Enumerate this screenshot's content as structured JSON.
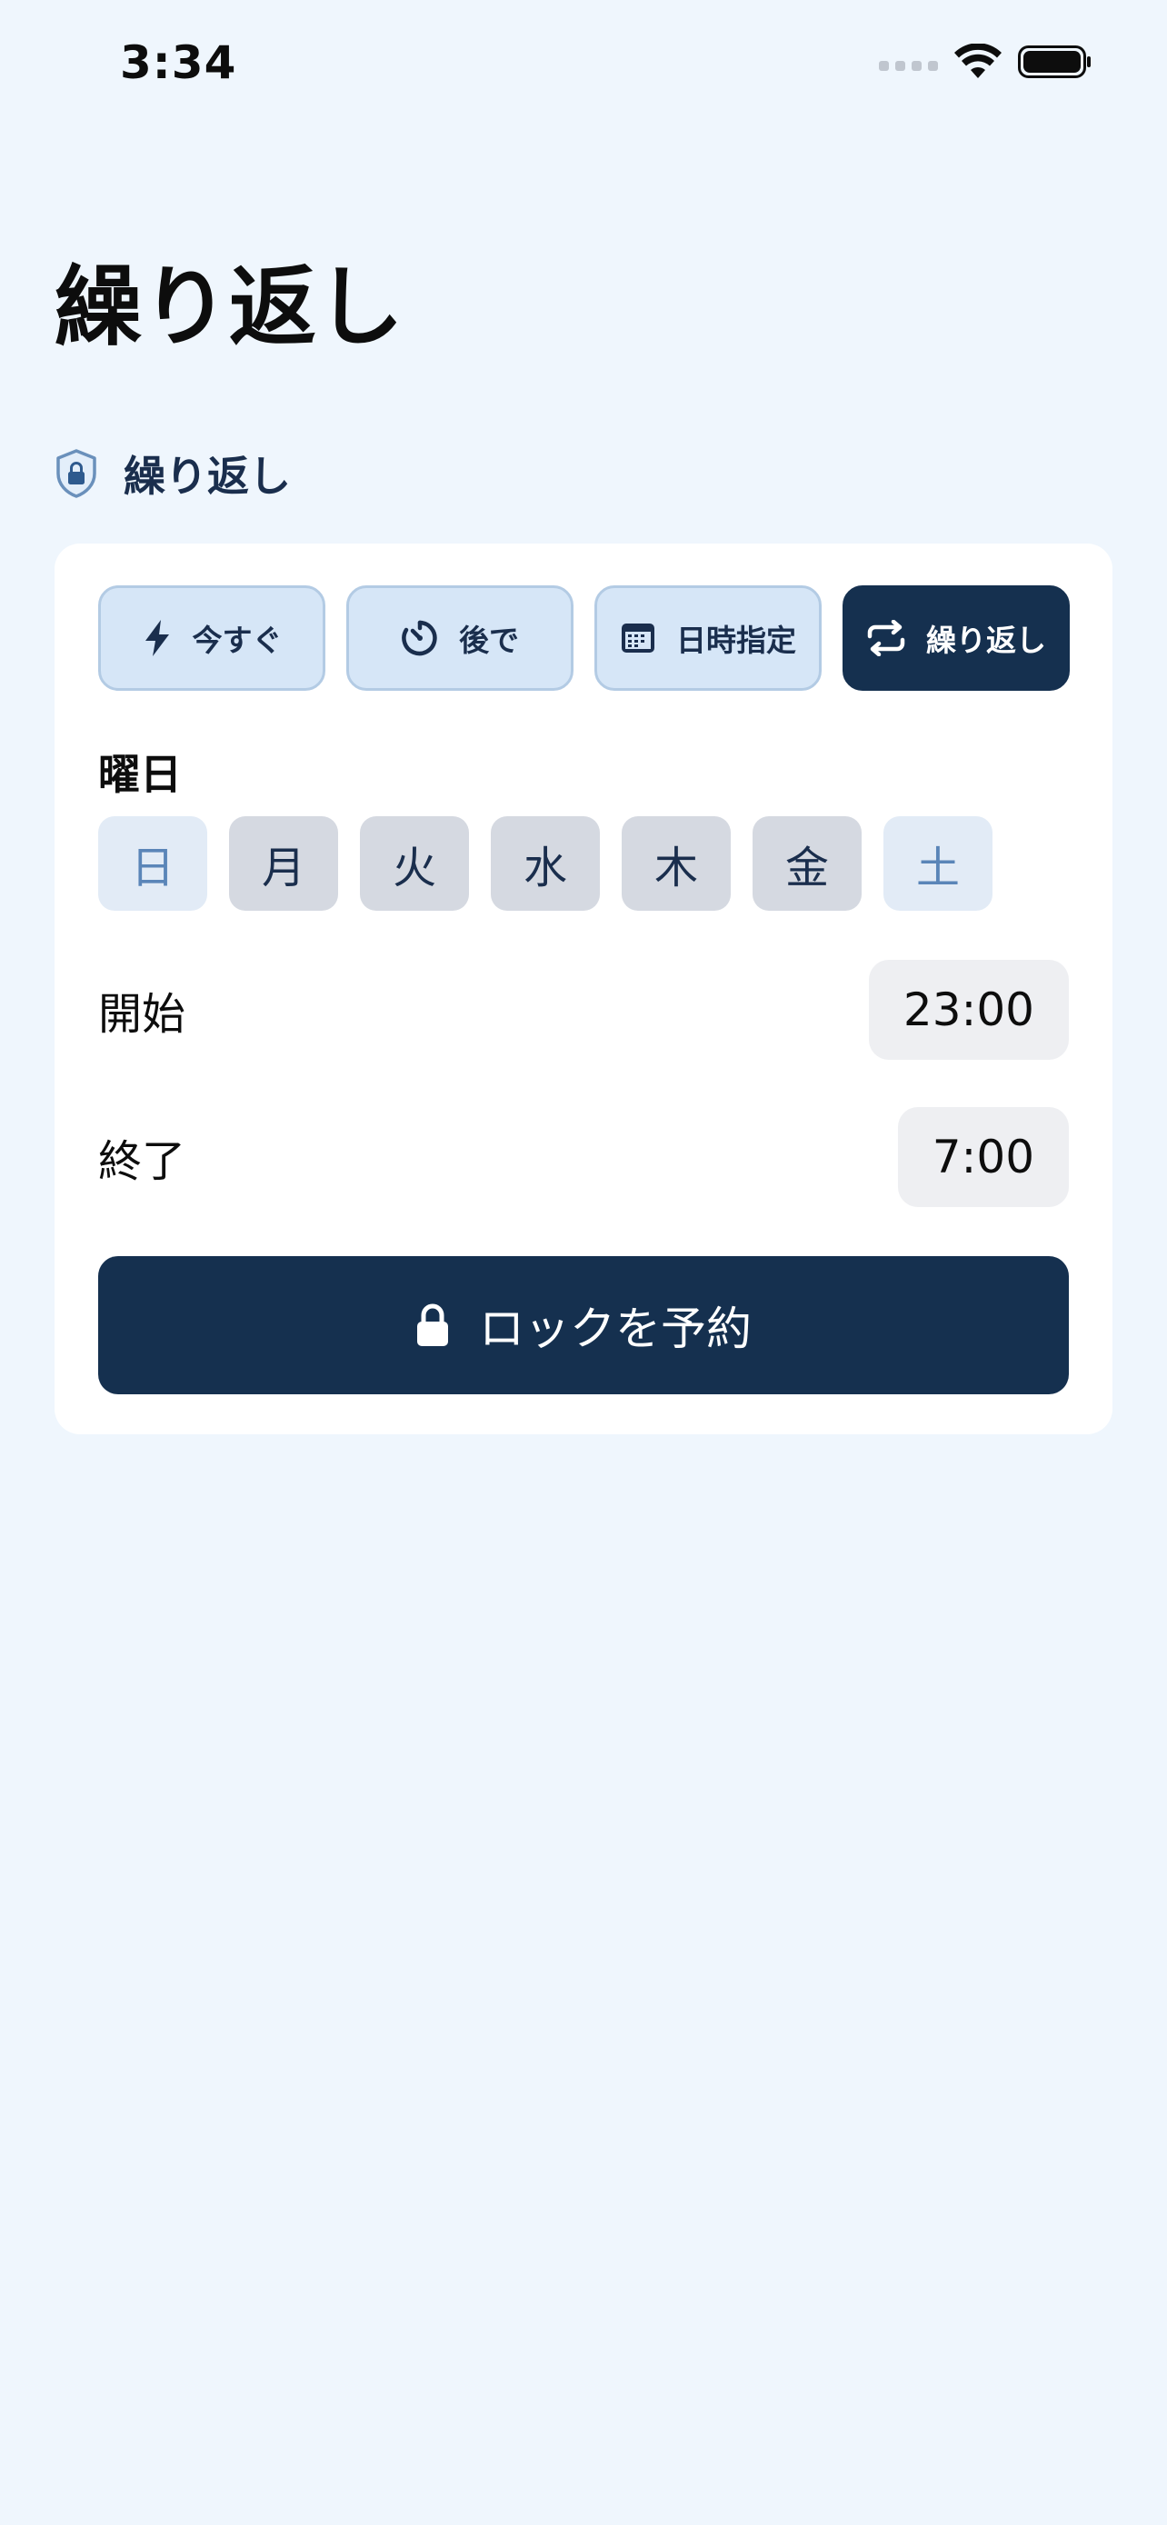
{
  "status_bar": {
    "time": "3:34"
  },
  "page": {
    "title": "繰り返し"
  },
  "section": {
    "label": "繰り返し",
    "icon": "shield-lock-icon"
  },
  "mode_tabs": [
    {
      "label": "今すぐ",
      "icon": "bolt-icon",
      "active": false
    },
    {
      "label": "後で",
      "icon": "timer-icon",
      "active": false
    },
    {
      "label": "日時指定",
      "icon": "calendar-icon",
      "active": false
    },
    {
      "label": "繰り返し",
      "icon": "repeat-icon",
      "active": true
    }
  ],
  "weekdays": {
    "label": "曜日",
    "days": [
      {
        "label": "日",
        "selected": false
      },
      {
        "label": "月",
        "selected": true
      },
      {
        "label": "火",
        "selected": true
      },
      {
        "label": "水",
        "selected": true
      },
      {
        "label": "木",
        "selected": true
      },
      {
        "label": "金",
        "selected": true
      },
      {
        "label": "土",
        "selected": false
      }
    ]
  },
  "start": {
    "label": "開始",
    "value": "23:00"
  },
  "end": {
    "label": "終了",
    "value": "7:00"
  },
  "reserve_button": {
    "label": "ロックを予約",
    "icon": "lock-icon"
  },
  "colors": {
    "background": "#eff6fd",
    "accent": "#15304f",
    "chip_selected": "#d5d9e1",
    "chip_unselected": "#e2ebf6"
  }
}
